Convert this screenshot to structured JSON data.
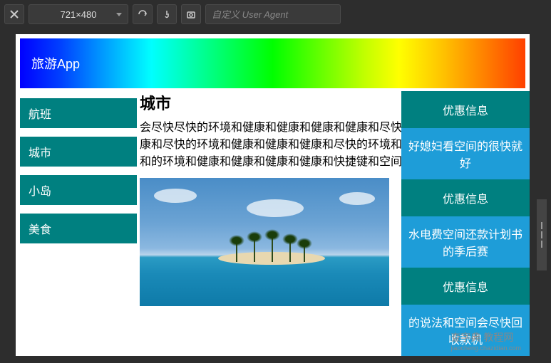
{
  "toolbar": {
    "resolution": "721×480",
    "ua_placeholder": "自定义 User Agent"
  },
  "header": {
    "title": "旅游App"
  },
  "sidebar": {
    "items": [
      {
        "label": "航班"
      },
      {
        "label": "城市"
      },
      {
        "label": "小岛"
      },
      {
        "label": "美食"
      }
    ]
  },
  "main": {
    "title": "城市",
    "text": "会尽快尽快的环境和健康和健康和健康和健康和尽快的环境和健康和健康和健康和尽快的环境和健康和健康和健康和尽快的环境和健康和健康和健康和健康和的环境和健康和健康和健康和健康和快捷键和空间好看"
  },
  "right_panel": {
    "sections": [
      {
        "header": "优惠信息",
        "content": "好媳妇看空间的很快就好"
      },
      {
        "header": "优惠信息",
        "content": "水电费空间还款计划书的季后赛"
      },
      {
        "header": "优惠信息",
        "content": "的说法和空间会尽快回收款机"
      }
    ]
  },
  "watermark": {
    "main": "查字典 教程网",
    "sub": "jiaocheng.chazidian.com"
  }
}
